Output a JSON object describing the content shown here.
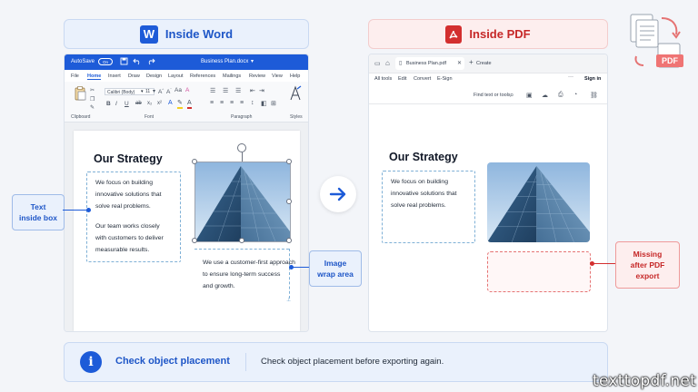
{
  "headers": {
    "word": {
      "title": "Inside Word",
      "logo_letter": "W"
    },
    "pdf": {
      "title": "Inside PDF"
    }
  },
  "word": {
    "autosave": "AutoSave",
    "toggle": "On",
    "filename": "Business Plan.docx",
    "menu": [
      "File",
      "Home",
      "Insert",
      "Draw",
      "Design",
      "Layout",
      "References",
      "Mailings",
      "Review",
      "View",
      "Help"
    ],
    "active_menu": "Home",
    "font_name": "Calibri (Body)",
    "font_size": "11",
    "groups": [
      "Clipboard",
      "Font",
      "Paragraph",
      "Styles"
    ],
    "format_buttons": [
      "B",
      "I",
      "U"
    ],
    "doc": {
      "heading": "Our Strategy",
      "box_lines": [
        "We focus on building",
        "innovative solutions that",
        "solve real problems."
      ],
      "box_lines2": [
        "Our team works closely",
        "with customers to deliver",
        "measurable results."
      ],
      "wrap_lines": [
        "We use a customer-first approach",
        "to ensure long-term success",
        "and growth."
      ]
    }
  },
  "pdf": {
    "tab_name": "Business Plan.pdf",
    "create": "Create",
    "signin": "Sign in",
    "menu": [
      "All tools",
      "Edit",
      "Convert",
      "E-Sign"
    ],
    "more": "···",
    "find": "Find text or tools",
    "doc": {
      "heading": "Our Strategy",
      "box_lines": [
        "We focus on building",
        "innovative solutions that",
        "solve real problems."
      ]
    }
  },
  "callouts": {
    "text_box": [
      "Text",
      "inside box"
    ],
    "image_wrap": [
      "Image",
      "wrap area"
    ],
    "missing": [
      "Missing",
      "after PDF",
      "export"
    ]
  },
  "badge": {
    "label": "PDF"
  },
  "bottom": {
    "title": "Check object placement",
    "message": "Check object placement before exporting again."
  },
  "watermark": "texttopdf.net",
  "colors": {
    "word_blue": "#1d5bd8",
    "pdf_red": "#d32f2f",
    "accent": "#1e56c7"
  }
}
